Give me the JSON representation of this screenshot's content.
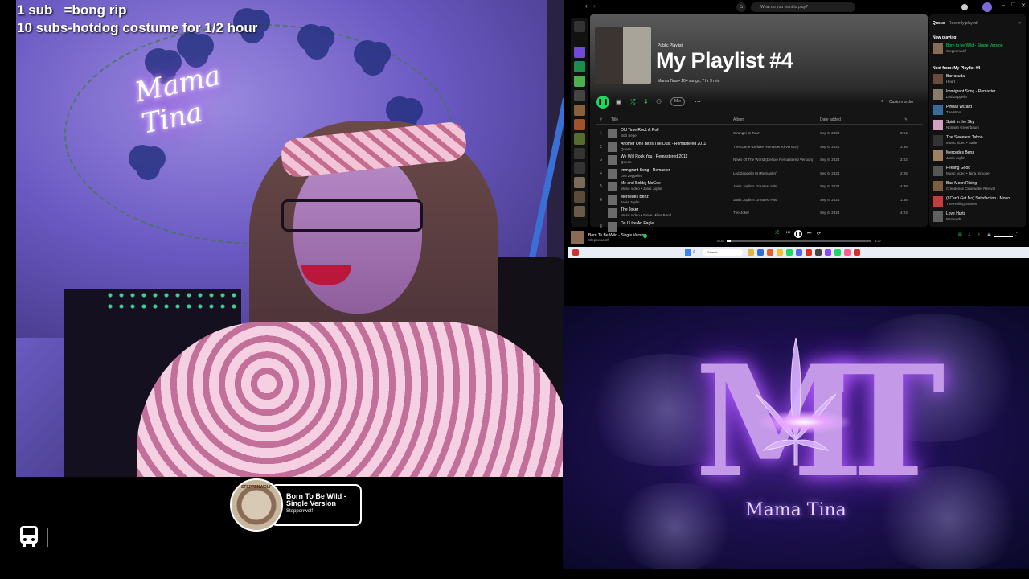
{
  "overlay": {
    "line1": "1 sub   =bong rip",
    "line2": "10 subs-hotdog costume for 1/2 hour",
    "neon_sign": "Mama Tina"
  },
  "now_playing": {
    "title": "Born To Be Wild - Single Version",
    "artist": "Steppenwolf",
    "album_art_text": "STEPPENWOLF"
  },
  "spotify": {
    "search_placeholder": "What do you want to play?",
    "playlist_type": "Public Playlist",
    "playlist_title": "My Playlist #4",
    "playlist_meta": "Mama Tina • 104 songs, 7 hr 3 min",
    "mix_label": "Mix",
    "custom_order": "Custom order",
    "headers": {
      "num": "#",
      "title": "Title",
      "album": "Album",
      "date": "Date added"
    },
    "tracks": [
      {
        "num": "1",
        "title": "Old Time Rock & Roll",
        "artist": "Bob Seger",
        "album": "Stranger In Town",
        "date": "Sep 6, 2024",
        "dur": "3:14"
      },
      {
        "num": "2",
        "title": "Another One Bites The Dust - Remastered 2011",
        "artist": "Queen",
        "album": "The Game (Deluxe Remastered Version)",
        "date": "Sep 6, 2024",
        "dur": "3:35"
      },
      {
        "num": "3",
        "title": "We Will Rock You - Remastered 2011",
        "artist": "Queen",
        "album": "News Of The World (Deluxe Remastered Version)",
        "date": "Sep 6, 2024",
        "dur": "2:02"
      },
      {
        "num": "4",
        "title": "Immigrant Song - Remaster",
        "artist": "Led Zeppelin",
        "album": "Led Zeppelin III (Remaster)",
        "date": "Sep 6, 2024",
        "dur": "2:26"
      },
      {
        "num": "5",
        "title": "Me and Bobby McGee",
        "artist": "Music video • Janis Joplin",
        "album": "Janis Joplin's Greatest Hits",
        "date": "Sep 6, 2024",
        "dur": "4:39"
      },
      {
        "num": "6",
        "title": "Mercedes Benz",
        "artist": "Janis Joplin",
        "album": "Janis Joplin's Greatest Hits",
        "date": "Sep 6, 2024",
        "dur": "1:46"
      },
      {
        "num": "7",
        "title": "The Joker",
        "artist": "Music video • Steve Miller Band",
        "album": "The Joker",
        "date": "Sep 6, 2024",
        "dur": "4:23"
      },
      {
        "num": "8",
        "title": "Do I Like An Eagle",
        "artist": "",
        "album": "",
        "date": "",
        "dur": ""
      }
    ],
    "queue_tab": "Queue",
    "recent_tab": "Recently played",
    "now_playing_label": "Now playing",
    "now_playing_title": "Born to be Wild - Single Version",
    "now_playing_artist": "Steppenwolf",
    "next_from": "Next from: My Playlist #4",
    "queue": [
      {
        "title": "Barracuda",
        "artist": "Heart"
      },
      {
        "title": "Immigrant Song - Remaster",
        "artist": "Led Zeppelin"
      },
      {
        "title": "Pinball Wizard",
        "artist": "The Who"
      },
      {
        "title": "Spirit in the Sky",
        "artist": "Norman Greenbaum"
      },
      {
        "title": "The Sweetest Taboo",
        "artist": "Music video • Sade"
      },
      {
        "title": "Mercedes Benz",
        "artist": "Janis Joplin"
      },
      {
        "title": "Feeling Good",
        "artist": "Music video • Nina Simone"
      },
      {
        "title": "Bad Moon Rising",
        "artist": "Creedence Clearwater Revival"
      },
      {
        "title": "(I Can't Get No) Satisfaction - Mono",
        "artist": "The Rolling Stones"
      },
      {
        "title": "Love Hurts",
        "artist": "Nazareth"
      }
    ],
    "player_title": "Born To Be Wild - Single Version",
    "player_artist": "Steppenwolf",
    "elapsed": "0:05",
    "total": "3:32",
    "progress": 0.03,
    "taskbar_search": "Search"
  },
  "logo": {
    "monogram": "MT",
    "name": "Mama Tina"
  },
  "colors": {
    "spotify_green": "#1ed760",
    "neon_purple": "#b05cff"
  }
}
